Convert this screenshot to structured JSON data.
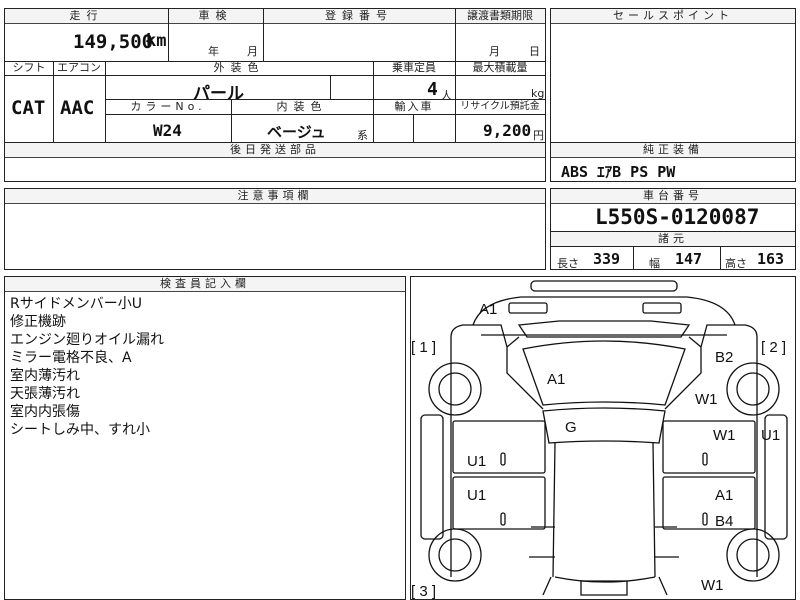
{
  "header": {
    "mileage_label": "走行",
    "inspection_label": "車検",
    "registration_label": "登録番号",
    "transfer_label": "譲渡書類期限",
    "selling_points_label": "セールスポイント"
  },
  "mileage": {
    "value": "149,500",
    "unit": "km"
  },
  "inspection_units": {
    "year": "年",
    "month": "月"
  },
  "transfer_units": {
    "month": "月",
    "day": "日"
  },
  "row2_labels": {
    "shift": "シフト",
    "aircon": "エアコン",
    "exterior": "外装色",
    "capacity": "乗車定員",
    "max_load": "最大積載量"
  },
  "shift": "CAT",
  "aircon": "AAC",
  "exterior_color": "パール",
  "capacity": {
    "value": "4",
    "unit": "人"
  },
  "max_load": {
    "value": "",
    "unit": "kg"
  },
  "row3_labels": {
    "color_no": "カラーNo.",
    "interior": "内装色",
    "import": "輸入車",
    "recycle": "リサイクル預託金"
  },
  "color_no": "W24",
  "interior_color": {
    "value": "ベージュ",
    "suffix": "系"
  },
  "recycle_fee": {
    "value": "9,200",
    "unit": "円"
  },
  "later_parts_label": "後日発送部品",
  "standard_equipment": {
    "label": "純正装備",
    "value": "ABS ｴｱB PS PW"
  },
  "notes_label": "注意事項欄",
  "chassis": {
    "label": "車台番号",
    "value": "L550S-0120087"
  },
  "specs": {
    "label": "諸元",
    "length_label": "長さ",
    "length": "339",
    "width_label": "幅",
    "width": "147",
    "height_label": "高さ",
    "height": "163"
  },
  "inspector": {
    "label": "検査員記入欄",
    "lines": [
      "Rサイドメンバー小U",
      "修正機跡",
      "エンジン廻りオイル漏れ",
      "ミラー電格不良、A",
      "室内薄汚れ",
      "天張薄汚れ",
      "室内内張傷",
      "シートしみ中、すれ小"
    ]
  },
  "diagram": {
    "corners": {
      "c1": "[ 1 ]",
      "c2": "[ 2 ]",
      "c3": "[ 3 ]"
    },
    "marks": {
      "front": "A1",
      "hood": "A1",
      "roof": "G",
      "front_right": "B2",
      "right_fender": "W1",
      "right_front_door": "W1",
      "right_side": "U1",
      "left_front_door": "U1",
      "left_rear_door": "U1",
      "right_rear_door_a": "A1",
      "right_rear_door_b": "B4",
      "right_rear": "W1"
    }
  }
}
